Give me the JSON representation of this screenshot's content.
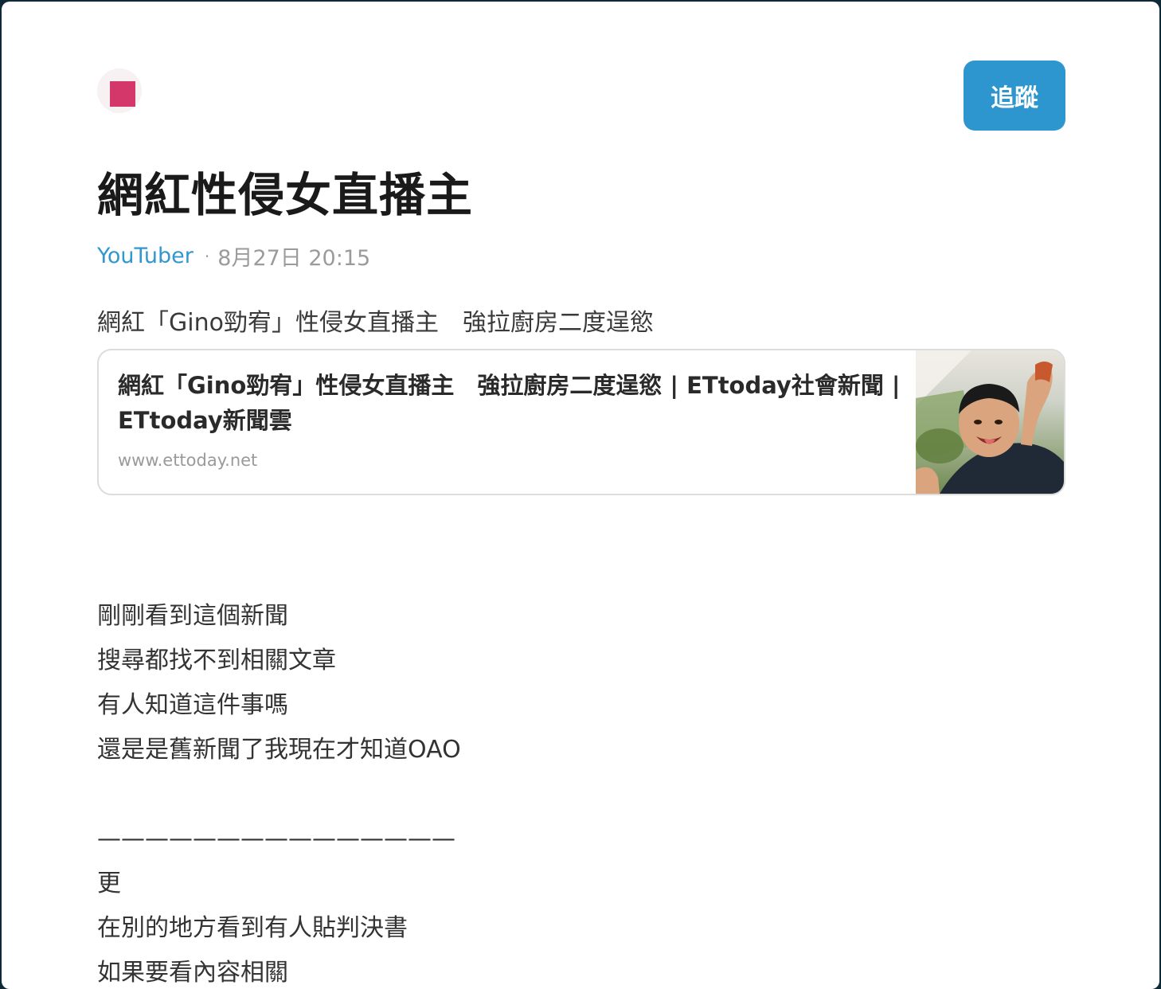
{
  "author": {
    "name": "",
    "follow_label": "追蹤"
  },
  "post": {
    "title": "網紅性侵女直播主",
    "forum": "YouTuber",
    "separator": "·",
    "timestamp": "8月27日 20:15",
    "intro": "網紅「Gino勁宥」性侵女直播主　強拉廚房二度逞慾"
  },
  "link_card": {
    "title": "網紅「Gino勁宥」性侵女直播主　強拉廚房二度逞慾 | ETtoday社會新聞 | ETtoday新聞雲",
    "domain": "www.ettoday.net"
  },
  "body": {
    "lines": [
      "剛剛看到這個新聞",
      "搜尋都找不到相關文章",
      "有人知道這件事嗎",
      "還是是舊新聞了我現在才知道OAO",
      "",
      "———————————————",
      "更",
      "在別的地方看到有人貼判決書",
      "如果要看內容相關"
    ]
  },
  "colors": {
    "accent": "#2e96cf",
    "forum_link": "#3397cf",
    "avatar_badge": "#d4376a"
  }
}
